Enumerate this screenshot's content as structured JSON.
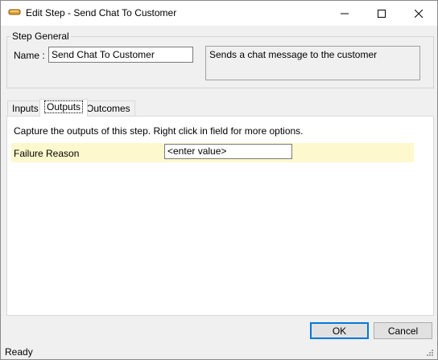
{
  "window": {
    "title": "Edit Step - Send Chat To Customer",
    "icon": "step-icon",
    "controls": [
      "minimize-icon",
      "maximize-icon",
      "close-icon"
    ]
  },
  "step_general": {
    "group_label": "Step General",
    "name_label": "Name :",
    "name_value": "Send Chat To Customer",
    "description": "Sends a chat message to the customer"
  },
  "tabs": [
    {
      "label": "Inputs",
      "selected": false
    },
    {
      "label": "Outputs",
      "selected": true
    },
    {
      "label": "Outcomes",
      "selected": false
    }
  ],
  "outputs": {
    "instructions": "Capture the outputs of this step.  Right click in field for more options.",
    "fields": [
      {
        "label": "Failure Reason",
        "value": "<enter value>"
      }
    ]
  },
  "buttons": {
    "ok_label": "OK",
    "cancel_label": "Cancel"
  },
  "status": {
    "text": "Ready"
  },
  "colors": {
    "field_row_bg": "#fdf8cd",
    "default_button_border": "#0078d7"
  }
}
